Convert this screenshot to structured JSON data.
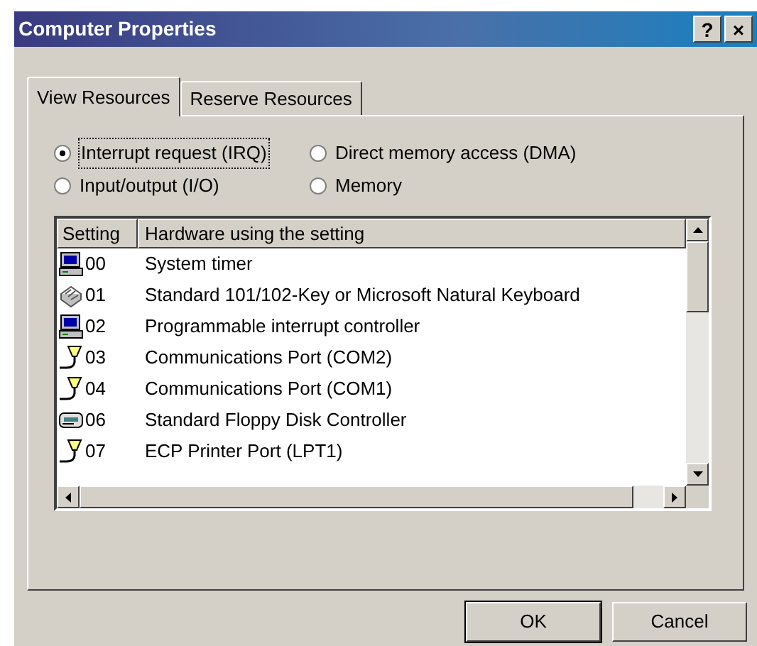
{
  "window": {
    "title": "Computer Properties",
    "title_buttons": [
      "?",
      "×"
    ]
  },
  "tabs": [
    {
      "label": "View Resources",
      "selected": true
    },
    {
      "label": "Reserve Resources",
      "selected": false
    }
  ],
  "radios": [
    {
      "label": "Interrupt request (IRQ)",
      "selected": true
    },
    {
      "label": "Direct memory access (DMA)",
      "selected": false
    },
    {
      "label": "Input/output (I/O)",
      "selected": false
    },
    {
      "label": "Memory",
      "selected": false
    }
  ],
  "table": {
    "columns": [
      "Setting",
      "Hardware using the setting"
    ],
    "rows": [
      {
        "kind": "computer",
        "setting": "00",
        "hardware": "System timer"
      },
      {
        "kind": "keyboard",
        "setting": "01",
        "hardware": "Standard 101/102-Key or Microsoft Natural Keyboard"
      },
      {
        "kind": "computer",
        "setting": "02",
        "hardware": "Programmable interrupt controller"
      },
      {
        "kind": "port",
        "setting": "03",
        "hardware": "Communications Port (COM2)"
      },
      {
        "kind": "port",
        "setting": "04",
        "hardware": "Communications Port (COM1)"
      },
      {
        "kind": "floppy",
        "setting": "06",
        "hardware": "Standard Floppy Disk Controller"
      },
      {
        "kind": "port",
        "setting": "07",
        "hardware": "ECP Printer Port (LPT1)"
      }
    ]
  },
  "buttons": [
    "OK",
    "Cancel"
  ]
}
